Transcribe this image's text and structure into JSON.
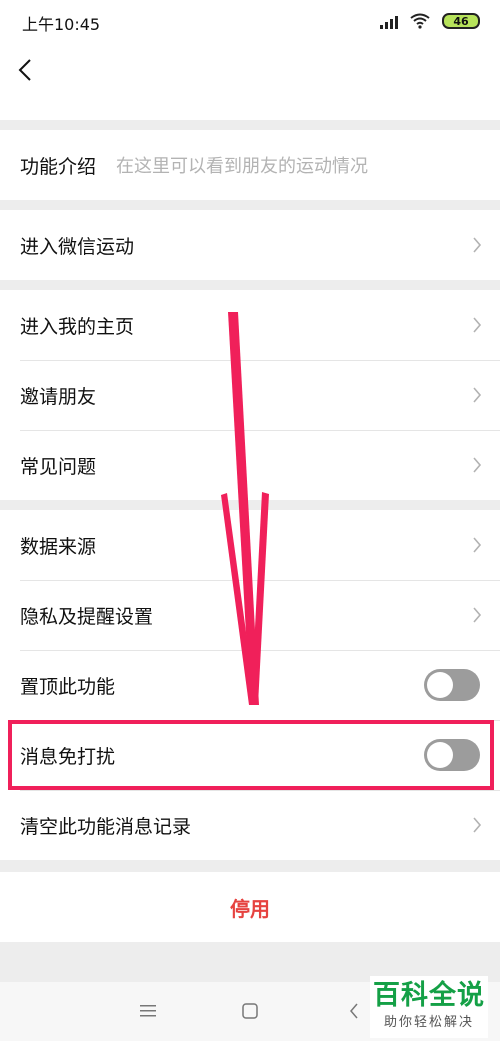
{
  "status_bar": {
    "time": "上午10:45",
    "battery": "46"
  },
  "intro": {
    "label": "功能介绍",
    "description": "在这里可以看到朋友的运动情况"
  },
  "group1": [
    {
      "label": "进入微信运动"
    }
  ],
  "group2": [
    {
      "label": "进入我的主页"
    },
    {
      "label": "邀请朋友"
    },
    {
      "label": "常见问题"
    }
  ],
  "group3": [
    {
      "label": "数据来源"
    },
    {
      "label": "隐私及提醒设置"
    },
    {
      "label": "置顶此功能",
      "toggle_on": false
    },
    {
      "label": "消息免打扰",
      "toggle_on": false
    },
    {
      "label": "清空此功能消息记录"
    }
  ],
  "disable_label": "停用",
  "watermark": {
    "title": "百科全说",
    "subtitle": "助你轻松解决"
  },
  "colors": {
    "accent_red": "#e64340",
    "annotation": "#f0205a",
    "watermark_green": "#14a046"
  },
  "icons": [
    "signal-icon",
    "wifi-icon",
    "battery-icon",
    "back-icon",
    "chevron-right-icon",
    "menu-icon",
    "home-icon",
    "back-nav-icon"
  ]
}
